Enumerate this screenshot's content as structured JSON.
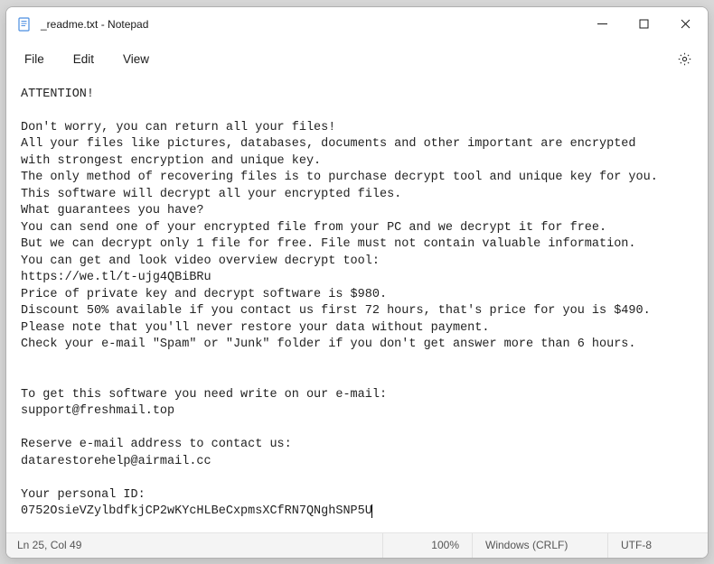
{
  "window": {
    "title": "_readme.txt - Notepad"
  },
  "menu": {
    "file": "File",
    "edit": "Edit",
    "view": "View"
  },
  "content": {
    "text": "ATTENTION!\n\nDon't worry, you can return all your files!\nAll your files like pictures, databases, documents and other important are encrypted\nwith strongest encryption and unique key.\nThe only method of recovering files is to purchase decrypt tool and unique key for you.\nThis software will decrypt all your encrypted files.\nWhat guarantees you have?\nYou can send one of your encrypted file from your PC and we decrypt it for free.\nBut we can decrypt only 1 file for free. File must not contain valuable information.\nYou can get and look video overview decrypt tool:\nhttps://we.tl/t-ujg4QBiBRu\nPrice of private key and decrypt software is $980.\nDiscount 50% available if you contact us first 72 hours, that's price for you is $490.\nPlease note that you'll never restore your data without payment.\nCheck your e-mail \"Spam\" or \"Junk\" folder if you don't get answer more than 6 hours.\n\n\nTo get this software you need write on our e-mail:\nsupport@freshmail.top\n\nReserve e-mail address to contact us:\ndatarestorehelp@airmail.cc\n\nYour personal ID:\n0752OsieVZylbdfkjCP2wKYcHLBeCxpmsXCfRN7QNghSNP5U"
  },
  "status": {
    "position": "Ln 25, Col 49",
    "zoom": "100%",
    "line_ending": "Windows (CRLF)",
    "encoding": "UTF-8"
  }
}
